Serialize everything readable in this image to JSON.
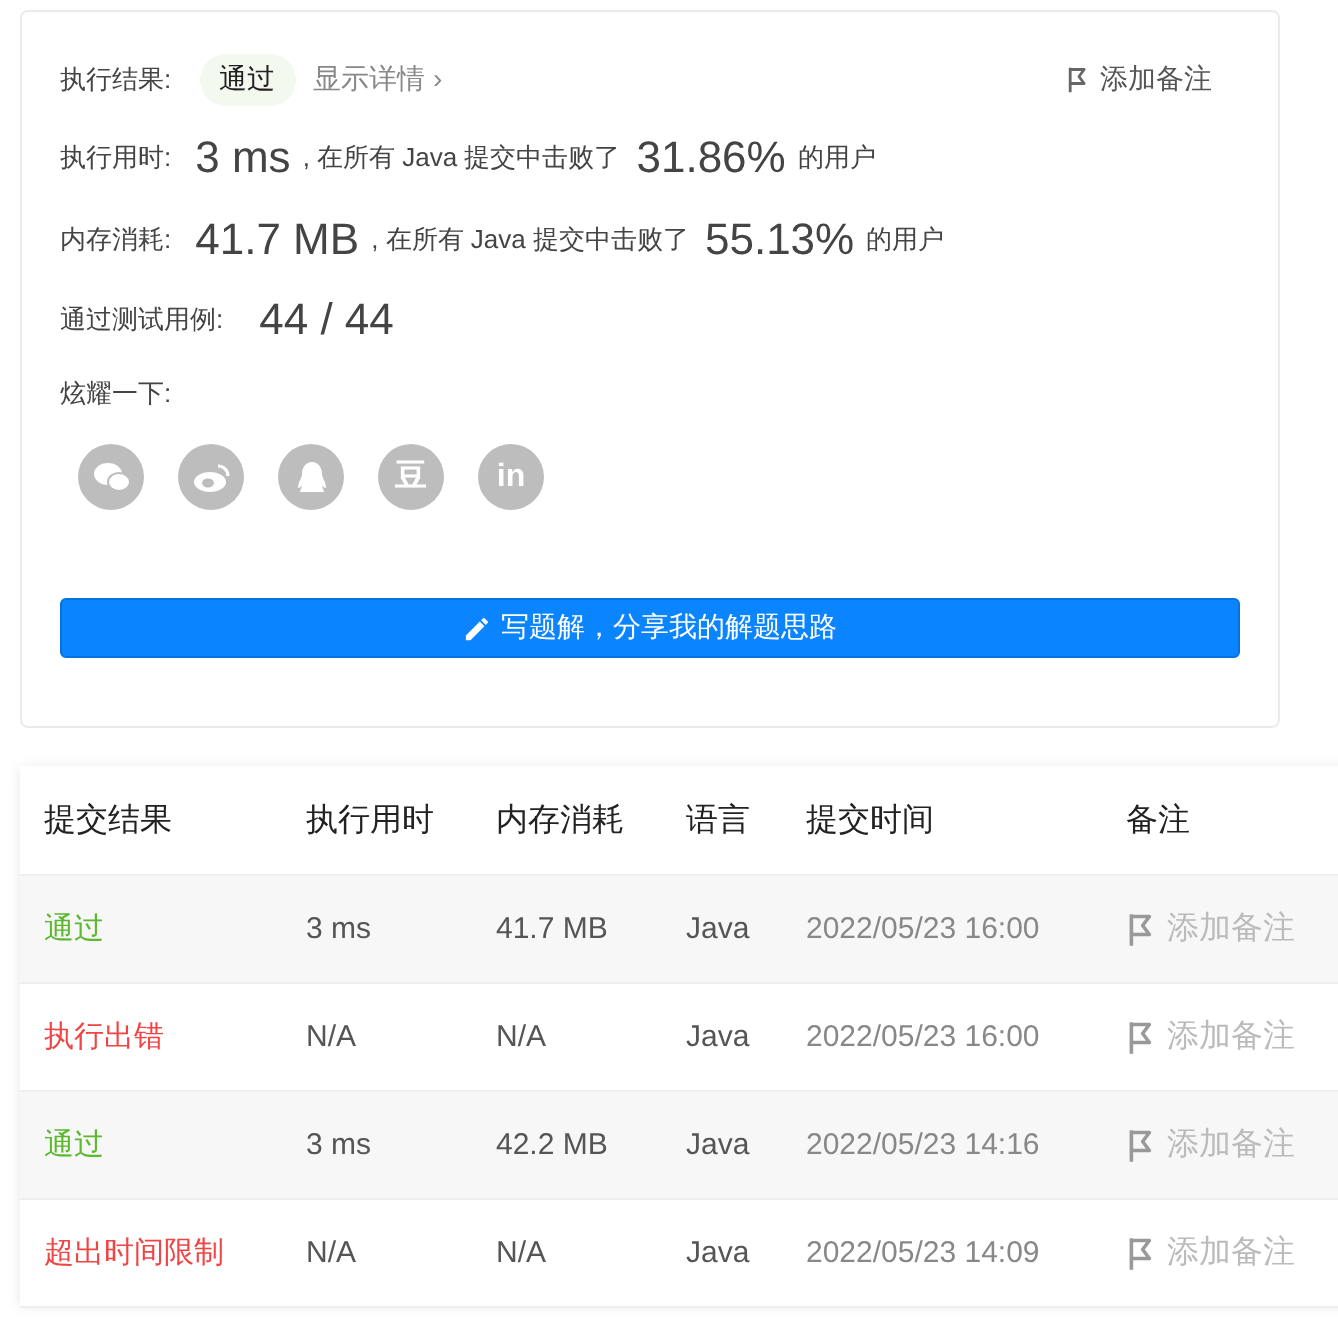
{
  "result": {
    "label": "执行结果:",
    "status": "通过",
    "details_link": "显示详情",
    "details_caret": "›",
    "note_button": "添加备注"
  },
  "stats": [
    {
      "label": "执行用时:",
      "value": "3 ms",
      "middle": ", 在所有 Java 提交中击败了",
      "percent": "31.86%",
      "suffix": "的用户"
    },
    {
      "label": "内存消耗:",
      "value": "41.7 MB",
      "middle": ", 在所有 Java 提交中击败了",
      "percent": "55.13%",
      "suffix": "的用户"
    }
  ],
  "testcases": {
    "label": "通过测试用例:",
    "value": "44 / 44"
  },
  "share": {
    "label": "炫耀一下:",
    "icons": [
      {
        "kind": "wechat"
      },
      {
        "kind": "weibo"
      },
      {
        "kind": "qq"
      },
      {
        "kind": "glyph",
        "glyph": "豆"
      },
      {
        "kind": "glyph",
        "glyph": "in"
      }
    ]
  },
  "solution_button": "写题解，分享我的解题思路",
  "table": {
    "columns": [
      "提交结果",
      "执行用时",
      "内存消耗",
      "语言",
      "提交时间",
      "备注"
    ],
    "rows": [
      {
        "status": "通过",
        "color": "#5cb82e",
        "time": "3 ms",
        "memory": "41.7 MB",
        "language": "Java",
        "submitted": "2022/05/23 16:00",
        "note": "添加备注"
      },
      {
        "status": "执行出错",
        "color": "#f04545",
        "time": "N/A",
        "memory": "N/A",
        "language": "Java",
        "submitted": "2022/05/23 16:00",
        "note": "添加备注"
      },
      {
        "status": "通过",
        "color": "#5cb82e",
        "time": "3 ms",
        "memory": "42.2 MB",
        "language": "Java",
        "submitted": "2022/05/23 14:16",
        "note": "添加备注"
      },
      {
        "status": "超出时间限制",
        "color": "#f04545",
        "time": "N/A",
        "memory": "N/A",
        "language": "Java",
        "submitted": "2022/05/23 14:09",
        "note": "添加备注"
      }
    ]
  }
}
